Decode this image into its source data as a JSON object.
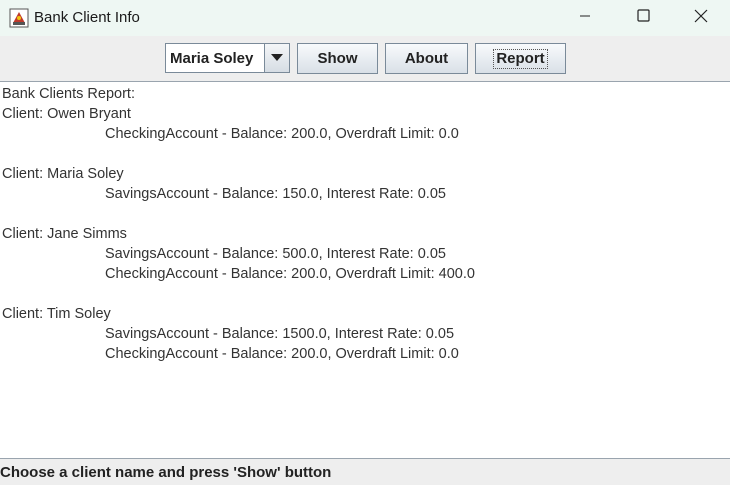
{
  "window": {
    "title": "Bank Client Info"
  },
  "toolbar": {
    "client_select": "Maria Soley",
    "show_label": "Show",
    "about_label": "About",
    "report_label": "Report"
  },
  "report": {
    "header": "Bank Clients Report:",
    "clients": [
      {
        "label": "Client: Owen Bryant",
        "accounts": [
          "CheckingAccount - Balance: 200.0, Overdraft Limit: 0.0"
        ]
      },
      {
        "label": "Client: Maria Soley",
        "accounts": [
          "SavingsAccount - Balance: 150.0, Interest Rate: 0.05"
        ]
      },
      {
        "label": "Client: Jane Simms",
        "accounts": [
          "SavingsAccount - Balance: 500.0, Interest Rate: 0.05",
          "CheckingAccount - Balance: 200.0, Overdraft Limit: 400.0"
        ]
      },
      {
        "label": "Client: Tim Soley",
        "accounts": [
          "SavingsAccount - Balance: 1500.0, Interest Rate: 0.05",
          "CheckingAccount - Balance: 200.0, Overdraft Limit: 0.0"
        ]
      }
    ]
  },
  "status": {
    "text": "Choose a client name and press 'Show' button"
  },
  "icons": {
    "app": "app-icon",
    "minimize": "minimize-icon",
    "maximize": "maximize-icon",
    "close": "close-icon",
    "dropdown": "chevron-down-icon"
  }
}
